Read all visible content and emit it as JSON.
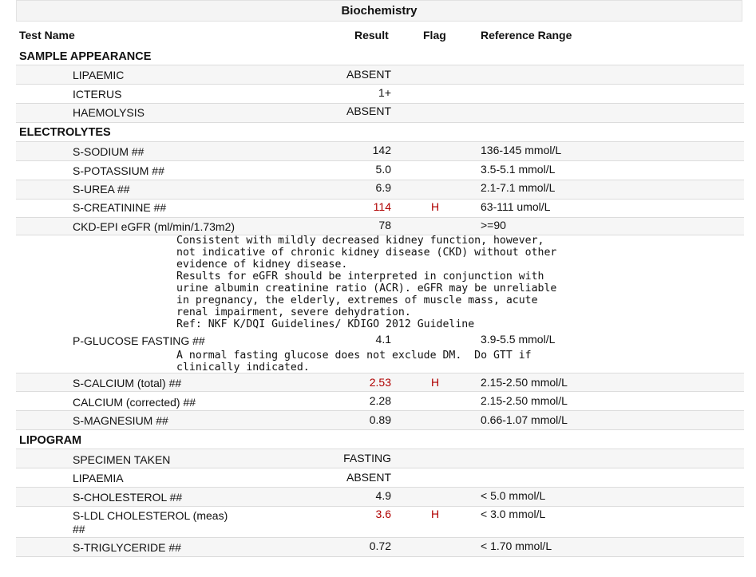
{
  "title": "Biochemistry",
  "columns": {
    "test": "Test Name",
    "result": "Result",
    "flag": "Flag",
    "range": "Reference Range"
  },
  "sections": {
    "sample": "SAMPLE APPEARANCE",
    "electrolytes": "ELECTROLYTES",
    "lipogram": "LIPOGRAM"
  },
  "tests": {
    "lipaemic": {
      "name": "LIPAEMIC",
      "result": "ABSENT",
      "flag": "",
      "range": ""
    },
    "icterus": {
      "name": "ICTERUS",
      "result": "1+",
      "flag": "",
      "range": ""
    },
    "haemolysis": {
      "name": "HAEMOLYSIS",
      "result": "ABSENT",
      "flag": "",
      "range": ""
    },
    "sodium": {
      "name": "S-SODIUM ##",
      "result": "142",
      "flag": "",
      "range": "136-145 mmol/L"
    },
    "potassium": {
      "name": "S-POTASSIUM ##",
      "result": "5.0",
      "flag": "",
      "range": "3.5-5.1 mmol/L"
    },
    "urea": {
      "name": "S-UREA ##",
      "result": "6.9",
      "flag": "",
      "range": "2.1-7.1 mmol/L"
    },
    "creatinine": {
      "name": "S-CREATININE ##",
      "result": "114",
      "flag": "H",
      "range": "63-111 umol/L"
    },
    "egfr": {
      "name": "CKD-EPI eGFR (ml/min/1.73m2)",
      "result": "78",
      "flag": "",
      "range": ">=90"
    },
    "glucose": {
      "name": "P-GLUCOSE FASTING ##",
      "result": "4.1",
      "flag": "",
      "range": "3.9-5.5 mmol/L"
    },
    "calcium_total": {
      "name": "S-CALCIUM (total) ##",
      "result": "2.53",
      "flag": "H",
      "range": "2.15-2.50 mmol/L"
    },
    "calcium_corr": {
      "name": "CALCIUM (corrected) ##",
      "result": "2.28",
      "flag": "",
      "range": "2.15-2.50 mmol/L"
    },
    "magnesium": {
      "name": "S-MAGNESIUM ##",
      "result": "0.89",
      "flag": "",
      "range": "0.66-1.07 mmol/L"
    },
    "specimen": {
      "name": "SPECIMEN TAKEN",
      "result": "FASTING",
      "flag": "",
      "range": ""
    },
    "lipaemia": {
      "name": "LIPAEMIA",
      "result": "ABSENT",
      "flag": "",
      "range": ""
    },
    "cholesterol": {
      "name": "S-CHOLESTEROL ##",
      "result": "4.9",
      "flag": "",
      "range": "< 5.0 mmol/L"
    },
    "ldl": {
      "name": "S-LDL CHOLESTEROL (meas)",
      "name2": "##",
      "result": "3.6",
      "flag": "H",
      "range": "< 3.0 mmol/L"
    },
    "triglyceride": {
      "name": "S-TRIGLYCERIDE ##",
      "result": "0.72",
      "flag": "",
      "range": "< 1.70 mmol/L"
    }
  },
  "comments": {
    "egfr": "Consistent with mildly decreased kidney function, however,\nnot indicative of chronic kidney disease (CKD) without other\nevidence of kidney disease.\nResults for eGFR should be interpreted in conjunction with\nurine albumin creatinine ratio (ACR). eGFR may be unreliable\nin pregnancy, the elderly, extremes of muscle mass, acute\nrenal impairment, severe dehydration.\nRef: NKF K/DQI Guidelines/ KDIGO 2012 Guideline",
    "glucose": "A normal fasting glucose does not exclude DM.  Do GTT if\nclinically indicated."
  },
  "colors": {
    "high": "#b00000",
    "row_alt": "#f6f6f6",
    "border": "#dcdcdc"
  }
}
